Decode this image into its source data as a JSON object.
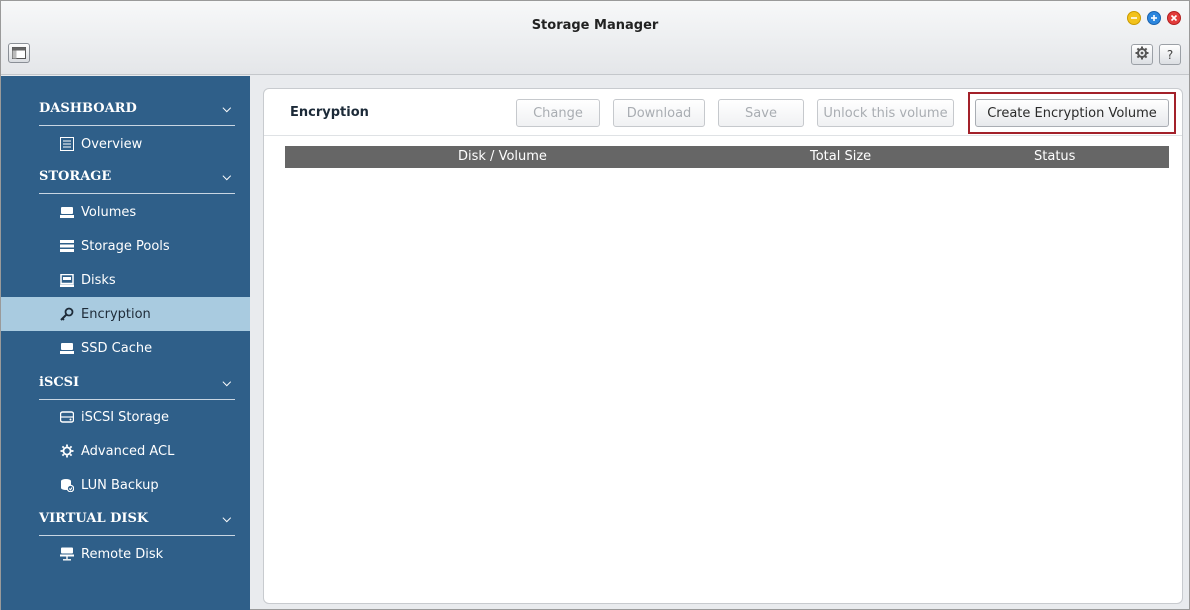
{
  "window": {
    "title": "Storage Manager",
    "controls": {
      "minimize": "⊖",
      "maximize": "⊕",
      "close": "⊗"
    }
  },
  "toolbar": {
    "settings_icon": "gear-icon",
    "help_label": "?"
  },
  "sidebar": {
    "sections": [
      {
        "title": "DASHBOARD",
        "items": [
          {
            "label": "Overview",
            "icon": "list-icon"
          }
        ]
      },
      {
        "title": "STORAGE",
        "items": [
          {
            "label": "Volumes",
            "icon": "volume-icon"
          },
          {
            "label": "Storage Pools",
            "icon": "pools-icon"
          },
          {
            "label": "Disks",
            "icon": "disk-icon"
          },
          {
            "label": "Encryption",
            "icon": "key-icon",
            "active": true
          },
          {
            "label": "SSD Cache",
            "icon": "ssd-icon"
          }
        ]
      },
      {
        "title": "iSCSI",
        "items": [
          {
            "label": "iSCSI Storage",
            "icon": "iscsi-icon"
          },
          {
            "label": "Advanced ACL",
            "icon": "gear-icon"
          },
          {
            "label": "LUN Backup",
            "icon": "backup-icon"
          }
        ]
      },
      {
        "title": "VIRTUAL DISK",
        "items": [
          {
            "label": "Remote Disk",
            "icon": "remote-disk-icon"
          }
        ]
      }
    ]
  },
  "main": {
    "title": "Encryption",
    "buttons": {
      "change": "Change",
      "download": "Download",
      "save": "Save",
      "unlock": "Unlock this volume",
      "create": "Create Encryption Volume"
    },
    "table": {
      "columns": [
        "Disk / Volume",
        "Total Size",
        "Status"
      ],
      "rows": []
    }
  },
  "colors": {
    "sidebar_bg": "#2f5f89",
    "active_item_bg": "#a9cbe0",
    "highlight_border": "#a3212a",
    "table_header_bg": "#666666"
  }
}
